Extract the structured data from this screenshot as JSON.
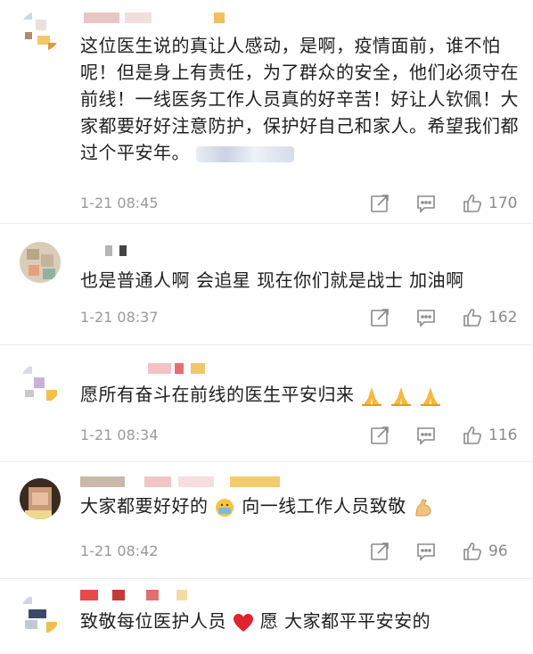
{
  "comments": [
    {
      "text": "这位医生说的真让人感动，是啊，疫情面前，谁不怕呢！但是身上有责任，为了群众的安全，他们必须守在前线！一线医务工作人员真的好辛苦！好让人钦佩！大家都要好好注意防护，保护好自己和家人。希望我们都过个平安年。",
      "time": "1-21 08:45",
      "likes": "170"
    },
    {
      "text": "也是普通人啊 会追星 现在你们就是战士 加油啊",
      "time": "1-21 08:37",
      "likes": "162"
    },
    {
      "text": "愿所有奋斗在前线的医生平安归来",
      "time": "1-21 08:34",
      "likes": "116"
    },
    {
      "text_a": "大家都要好好的",
      "text_b": " 向一线工作人员致敬",
      "time": "1-21 08:42",
      "likes": "96"
    },
    {
      "text_a": "致敬每位医护人员",
      "text_b": "愿 大家都平平安安的"
    }
  ],
  "icons": {
    "share": "share-icon",
    "comment": "comment-icon",
    "like": "thumbs-up-icon",
    "pray": "folded-hands-emoji",
    "worker": "face-with-medical-mask-emoji",
    "muscle": "flexed-biceps-emoji",
    "heart": "red-heart-emoji"
  },
  "colors": {
    "text": "#1f1f1f",
    "meta": "#9a9a9a",
    "icon": "#8a8a8a",
    "heart": "#e0232e"
  }
}
